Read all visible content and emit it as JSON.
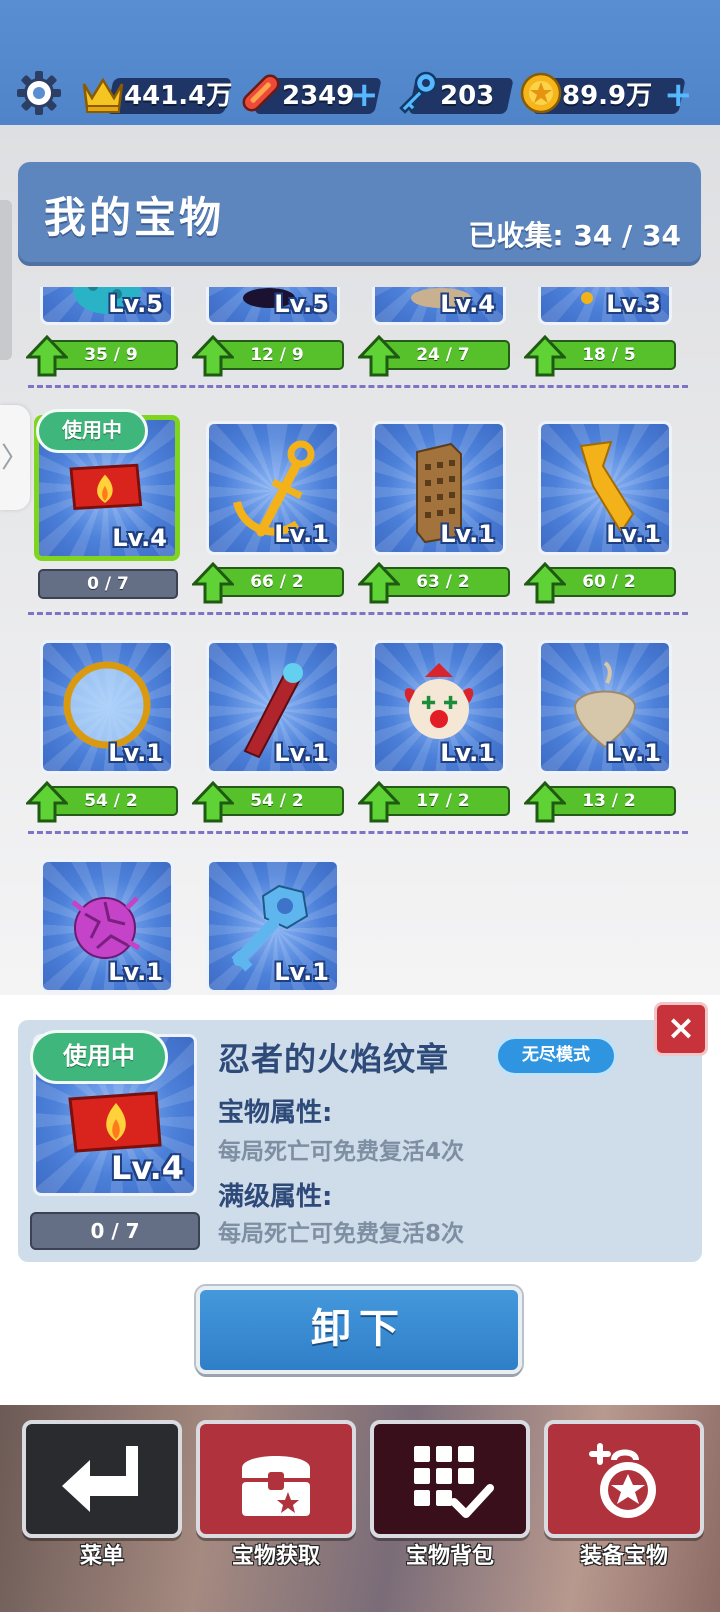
{
  "topbar": {
    "crowns": "441.4万",
    "boards": "2349",
    "keys": "203",
    "coins": "89.9万",
    "plus": "+"
  },
  "header": {
    "title": "我的宝物",
    "collected": "已收集: 34 / 34"
  },
  "side_tab": {
    "arrow": "〉"
  },
  "grid": {
    "row0": [
      {
        "level": "Lv.5",
        "progress": "35 / 9"
      },
      {
        "level": "Lv.5",
        "progress": "12 / 9"
      },
      {
        "level": "Lv.4",
        "progress": "24 / 7"
      },
      {
        "level": "Lv.3",
        "progress": "18 / 5"
      }
    ],
    "row1": [
      {
        "level": "Lv.4",
        "progress": "0 / 7",
        "badge": "使用中"
      },
      {
        "level": "Lv.1",
        "progress": "66 / 2"
      },
      {
        "level": "Lv.1",
        "progress": "63 / 2"
      },
      {
        "level": "Lv.1",
        "progress": "60 / 2"
      }
    ],
    "row2": [
      {
        "level": "Lv.1",
        "progress": "54 / 2"
      },
      {
        "level": "Lv.1",
        "progress": "54 / 2"
      },
      {
        "level": "Lv.1",
        "progress": "17 / 2"
      },
      {
        "level": "Lv.1",
        "progress": "13 / 2"
      }
    ],
    "row3": [
      {
        "level": "Lv.1"
      },
      {
        "level": "Lv.1"
      }
    ]
  },
  "detail": {
    "badge": "使用中",
    "level": "Lv.4",
    "progress": "0 / 7",
    "name": "忍者的火焰纹章",
    "mode": "无尽模式",
    "attr_title": "宝物属性:",
    "attr_desc": "每局死亡可免费复活4次",
    "max_title": "满级属性:",
    "max_desc": "每局死亡可免费复活8次",
    "close": "×",
    "unequip": "卸下"
  },
  "nav": [
    {
      "label": "菜单",
      "icon": "return-arrow-icon"
    },
    {
      "label": "宝物获取",
      "icon": "treasure-chest-icon"
    },
    {
      "label": "宝物背包",
      "icon": "grid-check-icon"
    },
    {
      "label": "装备宝物",
      "icon": "equip-treasure-icon"
    }
  ],
  "colors": {
    "accent_blue": "#2f7fc8",
    "active_green": "#7fd51d",
    "progress_green": "#57c12c",
    "close_red": "#c8323a"
  }
}
